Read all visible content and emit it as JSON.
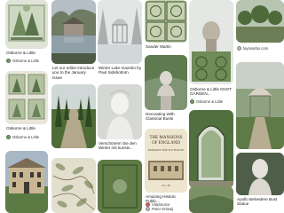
{
  "pins": [
    {
      "title": "Osborne & Little FOLIES...",
      "author": "Osborne & Little"
    },
    {
      "title": "Let our editor introduce you to the January Issue",
      "author": ""
    },
    {
      "title": "Winter Lake Gazebo by Paul Sidebottom",
      "author": ""
    },
    {
      "title": "Sander Martin",
      "author": ""
    },
    {
      "title": "",
      "author": "",
      "more": "···"
    },
    {
      "title": "",
      "author": "faymaxfox.com"
    },
    {
      "title": "Osborne & Little FOLIES...",
      "author": "Osborne & Little"
    },
    {
      "title": "Osborne & Little KNOT GARDEN...",
      "author": "Osborne & Little"
    },
    {
      "title": "Verschönern Sie den Winter mit kunstv...",
      "author": ""
    },
    {
      "title": "Decorating With Classical Busts",
      "author": ""
    },
    {
      "title": "The Most Awesome Garden Mirror Ideas That Took Our Bre...",
      "author": ""
    },
    {
      "title": "Amazing Historic Public...",
      "author": "Peter Orlowij"
    },
    {
      "title": "",
      "author": "VitaSource"
    },
    {
      "title": "Apollo Belvedere Bust Statue",
      "author": ""
    }
  ],
  "book": {
    "title": "THE MANSIONS OF ENGLAND",
    "subtitle": "PRIMARY BATTLE HOUSE",
    "caption": "No. 48"
  }
}
